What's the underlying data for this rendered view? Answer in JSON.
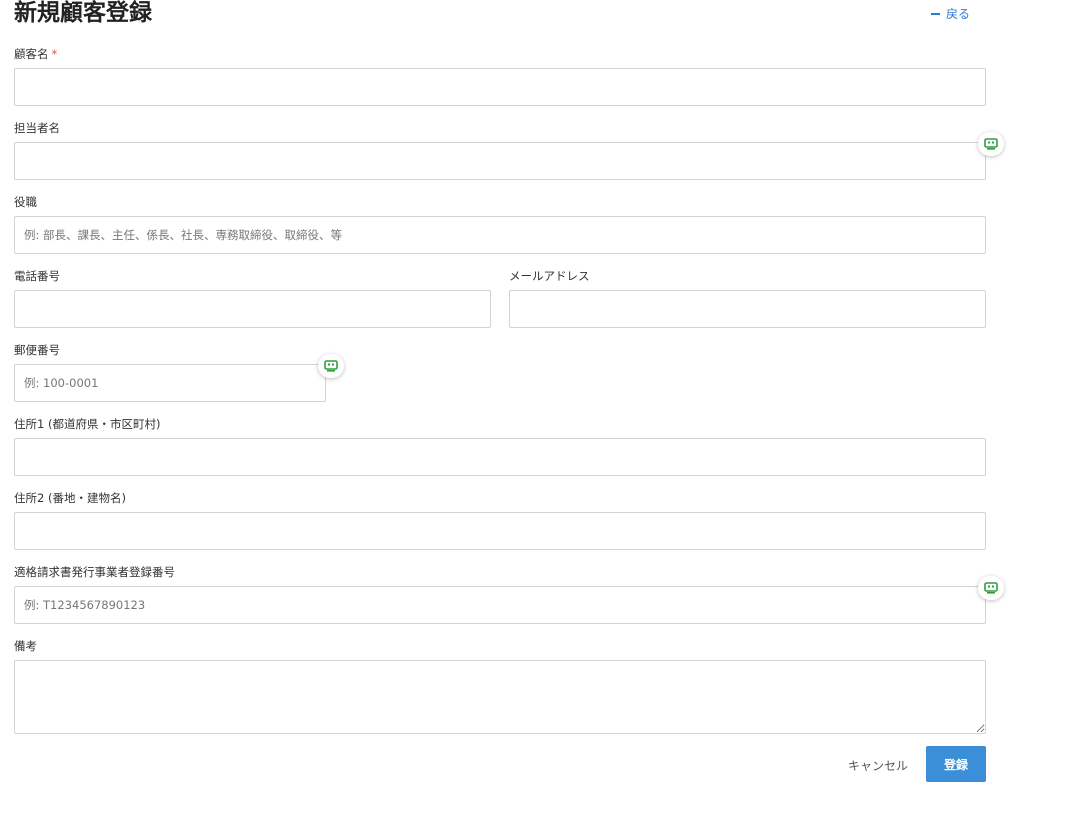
{
  "header": {
    "title": "新規顧客登録",
    "back_label": "戻る"
  },
  "form": {
    "customer_name": {
      "label": "顧客名",
      "required_mark": "*",
      "value": "",
      "placeholder": ""
    },
    "contact_person": {
      "label": "担当者名",
      "value": "",
      "placeholder": ""
    },
    "job_title": {
      "label": "役職",
      "value": "",
      "placeholder": "例: 部長、課長、主任、係長、社長、専務取締役、取締役、等"
    },
    "phone": {
      "label": "電話番号",
      "value": "",
      "placeholder": ""
    },
    "email": {
      "label": "メールアドレス",
      "value": "",
      "placeholder": ""
    },
    "postal_code": {
      "label": "郵便番号",
      "value": "",
      "placeholder": "例: 100-0001"
    },
    "address1": {
      "label": "住所1 (都道府県・市区町村)",
      "value": "",
      "placeholder": ""
    },
    "address2": {
      "label": "住所2 (番地・建物名)",
      "value": "",
      "placeholder": ""
    },
    "invoice_number": {
      "label": "適格請求書発行事業者登録番号",
      "value": "",
      "placeholder": "例: T1234567890123"
    },
    "notes": {
      "label": "備考",
      "value": "",
      "placeholder": ""
    }
  },
  "actions": {
    "cancel_label": "キャンセル",
    "submit_label": "登録"
  },
  "icons": {
    "back": "minus-icon",
    "autofill": "autofill-robot-icon"
  },
  "colors": {
    "accent": "#3a8fd8",
    "link": "#2a7bd4",
    "required": "#d9534f",
    "autofill_icon": "#2e9e3e"
  }
}
